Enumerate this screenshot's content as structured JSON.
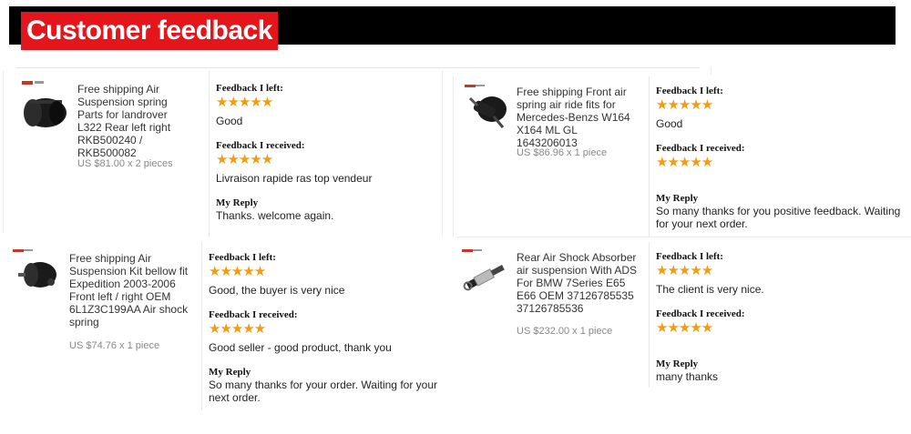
{
  "header": {
    "title": "Customer feedback"
  },
  "labels": {
    "left": "Feedback I left:",
    "received": "Feedback I received:",
    "reply": "My Reply"
  },
  "cards": [
    {
      "product": "Free shipping Air Suspension spring Parts for landrover L322 Rear left right RKB500240 / RKB500082",
      "price": "US $81.00 x 2 pieces",
      "stars_left": "★★★★★",
      "feedback_left": "Good",
      "stars_received": "★★★★★",
      "feedback_received": "Livraison rapide ras top vendeur",
      "reply": "Thanks. welcome again."
    },
    {
      "product": "Free shipping Front air spring air ride fits for Mercedes-Benzs W164 X164 ML GL 1643206013",
      "price": "US $86.96 x 1 piece",
      "stars_left": "★★★★★",
      "feedback_left": "Good",
      "stars_received": "★★★★★",
      "feedback_received": "",
      "reply": "So many thanks for you positive feedback. Waiting for your next order."
    },
    {
      "product": "Free shipping Air Suspension Kit bellow fit Expedition 2003-2006 Front left / right OEM 6L1Z3C199AA Air shock spring",
      "price": "US $74.76 x 1 piece",
      "stars_left": "★★★★★",
      "feedback_left": "Good, the buyer is very nice",
      "stars_received": "★★★★★",
      "feedback_received": "Good seller - good product, thank you",
      "reply": "So many thanks for your order. Waiting for your next order."
    },
    {
      "product": "Rear Air Shock Absorber air suspension With ADS For BMW 7Series E65 E66 OEM 37126785535 37126785536",
      "price": "US $232.00 x 1 piece",
      "stars_left": "★★★★★",
      "feedback_left": "The client is very nice.",
      "stars_received": "★★★★★",
      "feedback_received": "",
      "reply": "many thanks"
    }
  ]
}
